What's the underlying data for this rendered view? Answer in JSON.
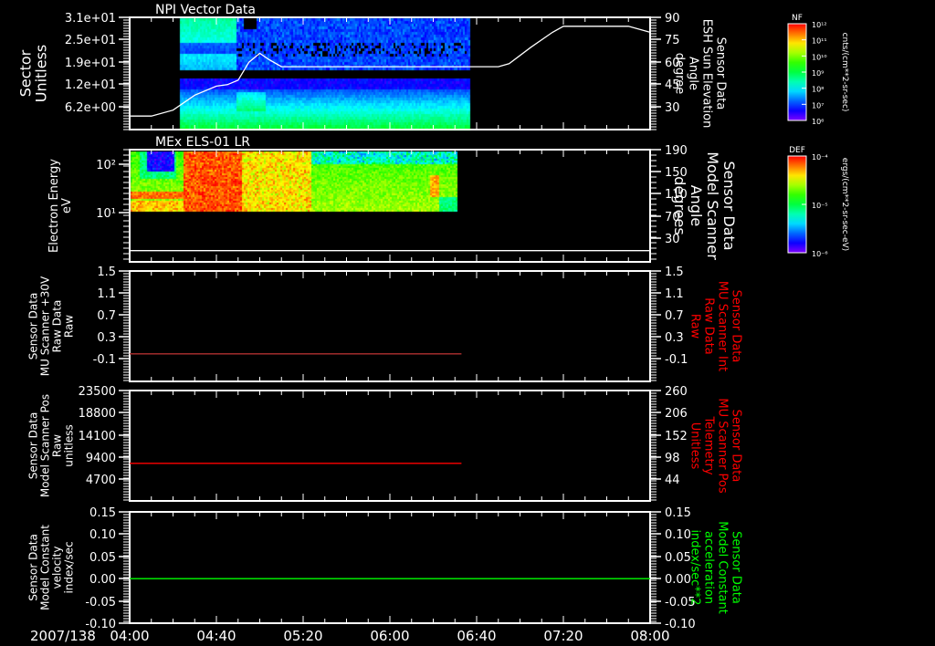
{
  "date_label": "2007/138",
  "time_axis": {
    "start_min": 0,
    "end_min": 240,
    "labels": [
      "04:00",
      "04:40",
      "05:20",
      "06:00",
      "06:40",
      "07:20",
      "08:00"
    ],
    "major_step_min": 40,
    "minor_step_min": 10
  },
  "colors": {
    "background": "#000000",
    "axis": "#ffffff",
    "red_label": "#ff0000",
    "green_label": "#00ff00"
  },
  "chart_data": [
    {
      "type": "heatmap",
      "title": "NPI Vector Data",
      "ylabel": [
        "Sector",
        "Unitless"
      ],
      "yticks": [
        "3.1e+01",
        "2.5e+01",
        "1.9e+01",
        "1.2e+01",
        "6.2e+00"
      ],
      "data_time_range_min": [
        23,
        157
      ],
      "colorbar": {
        "label": "NF",
        "ticks": [
          "10¹²",
          "10¹¹",
          "10¹⁰",
          "10⁹",
          "10⁸",
          "10⁷",
          "10⁶"
        ],
        "units": "cnts/(cm**2-sr-sec)"
      },
      "overlay": {
        "type": "line",
        "ylabel": [
          "Sensor Data",
          "ESH Sun Elevation",
          "Angle",
          "degree"
        ],
        "ylim": [
          15,
          90
        ],
        "yticks": [
          "90",
          "75",
          "60",
          "45",
          "30"
        ],
        "x_min": [
          0,
          10,
          20,
          30,
          40,
          45,
          50,
          55,
          60,
          64,
          70,
          100,
          170,
          175,
          185,
          195,
          200,
          230,
          240
        ],
        "y": [
          24,
          24,
          28,
          38,
          44,
          45,
          48,
          60,
          66,
          62,
          57,
          57,
          57,
          59,
          70,
          80,
          84,
          84,
          80
        ]
      }
    },
    {
      "type": "heatmap",
      "title": "MEx ELS-01 LR",
      "ylabel": [
        "Electron Energy",
        "eV"
      ],
      "yticks": [
        "10²",
        "10¹"
      ],
      "data_time_range_min": [
        0,
        151
      ],
      "colorbar": {
        "label": "DEF",
        "ticks": [
          "10⁻⁴",
          "10⁻⁵",
          "10⁻⁶"
        ],
        "units": "ergs/(cm**2-sr-sec-eV)"
      },
      "overlay": {
        "type": "line",
        "ylabel": [
          "Sensor Data",
          "Model Scanner",
          "Angle",
          "degrees"
        ],
        "ylim": [
          -10,
          190
        ],
        "yticks": [
          "190",
          "150",
          "110",
          "70",
          "30"
        ],
        "x_min": [
          0,
          240
        ],
        "y": [
          10,
          10
        ]
      }
    },
    {
      "type": "line",
      "ylabel": [
        "Sensor Data",
        "MU Scanner +30V",
        "Raw Data",
        "Raw"
      ],
      "ylim": [
        -0.5,
        1.5
      ],
      "yticks": [
        "1.5",
        "1.1",
        "0.7",
        "0.3",
        "-0.1"
      ],
      "series": [
        {
          "name": "MU Scanner +30V",
          "color": "#b03030",
          "x_min": [
            0,
            153
          ],
          "y": [
            0.0,
            0.0
          ]
        }
      ],
      "right_ylabel": [
        "Sensor Data",
        "MU Scanner Int",
        "Raw Data",
        "Raw"
      ],
      "right_yticks": [
        "1.5",
        "1.1",
        "0.7",
        "0.3",
        "-0.1"
      ]
    },
    {
      "type": "line",
      "ylabel": [
        "Sensor Data",
        "Model Scanner Pos",
        "Raw",
        "unitless"
      ],
      "ylim": [
        0,
        23500
      ],
      "yticks": [
        "23500",
        "18800",
        "14100",
        "9400",
        "4700"
      ],
      "series": [
        {
          "name": "Model Scanner Pos",
          "color": "#ff0000",
          "x_min": [
            0,
            153
          ],
          "y": [
            8000,
            8000
          ]
        }
      ],
      "right_ylabel": [
        "Sensor Data",
        "MU Scanner Pos",
        "Telemetry",
        "Unitless"
      ],
      "right_yticks": [
        "260",
        "206",
        "152",
        "98",
        "44"
      ]
    },
    {
      "type": "line",
      "ylabel": [
        "Sensor Data",
        "Model Constant",
        "velocity",
        "index/sec"
      ],
      "ylim": [
        -0.1,
        0.15
      ],
      "yticks": [
        "0.15",
        "0.10",
        "0.05",
        "0.00",
        "-0.05",
        "-0.10"
      ],
      "series": [
        {
          "name": "Model Constant velocity",
          "color": "#00ff00",
          "x_min": [
            0,
            240
          ],
          "y": [
            0,
            0
          ]
        }
      ],
      "right_ylabel": [
        "Sensor Data",
        "Model Constant",
        "acceleration",
        "index/sec**2"
      ],
      "right_yticks": [
        "0.15",
        "0.10",
        "0.05",
        "0.00",
        "-0.05",
        "-0.10"
      ]
    }
  ]
}
